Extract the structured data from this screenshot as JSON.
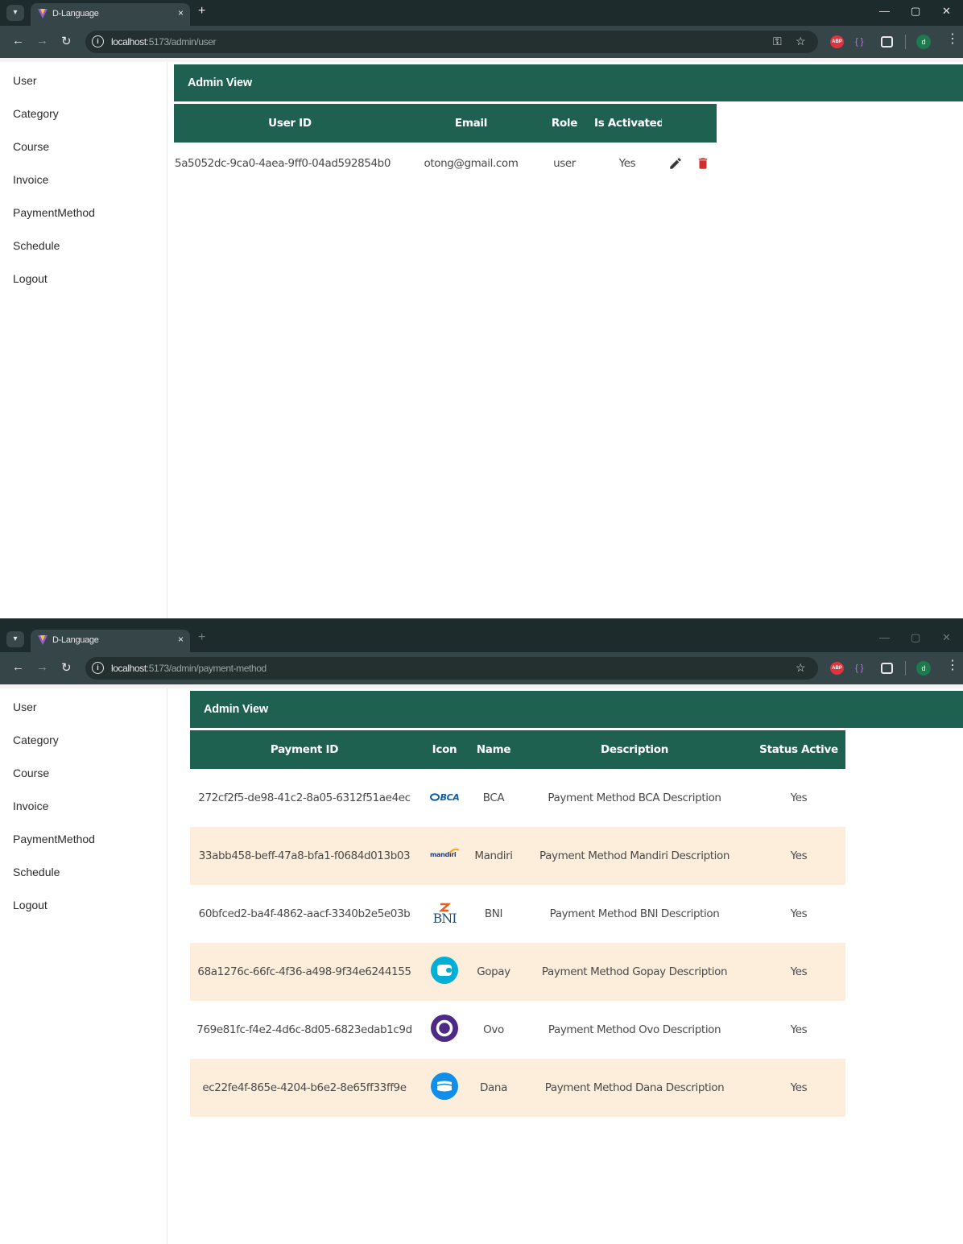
{
  "browser": {
    "tab_title": "D-Language",
    "tab_close": "×",
    "new_tab": "+",
    "menu_dropdown": "⌄"
  },
  "sidebar": {
    "items": [
      {
        "label": "User"
      },
      {
        "label": "Category"
      },
      {
        "label": "Course"
      },
      {
        "label": "Invoice"
      },
      {
        "label": "PaymentMethod"
      },
      {
        "label": "Schedule"
      },
      {
        "label": "Logout"
      }
    ]
  },
  "window1": {
    "url_host": "localhost",
    "url_path": ":5173/admin/user",
    "header_title": "Admin View",
    "table": {
      "columns": [
        "User ID",
        "Email",
        "Role",
        "Is Activated"
      ],
      "rows": [
        {
          "user_id": "5a5052dc-9ca0-4aea-9ff0-04ad592854b0",
          "email": "otong@gmail.com",
          "role": "user",
          "is_activated": "Yes"
        }
      ],
      "edit_icon": "pencil-icon",
      "delete_icon": "trash-icon",
      "delete_color": "#d32f2f"
    }
  },
  "window2": {
    "url_host": "localhost",
    "url_path": ":5173/admin/payment-method",
    "header_title": "Admin View",
    "table": {
      "columns": [
        "Payment ID",
        "Icon",
        "Name",
        "Description",
        "Status Active"
      ],
      "rows": [
        {
          "payment_id": "272cf2f5-de98-41c2-8a05-6312f51ae4ec",
          "icon": "bca-logo",
          "logo_text": "BCA",
          "name": "BCA",
          "description": "Payment Method BCA Description",
          "status": "Yes"
        },
        {
          "payment_id": "33abb458-beff-47a8-bfa1-f0684d013b03",
          "icon": "mandiri-logo",
          "logo_text": "mandiri",
          "name": "Mandiri",
          "description": "Payment Method Mandiri Description",
          "status": "Yes"
        },
        {
          "payment_id": "60bfced2-ba4f-4862-aacf-3340b2e5e03b",
          "icon": "bni-logo",
          "logo_text": "BNI",
          "name": "BNI",
          "description": "Payment Method BNI Description",
          "status": "Yes"
        },
        {
          "payment_id": "68a1276c-66fc-4f36-a498-9f34e6244155",
          "icon": "gopay-logo",
          "logo_text": "",
          "name": "Gopay",
          "description": "Payment Method Gopay Description",
          "status": "Yes"
        },
        {
          "payment_id": "769e81fc-f4e2-4d6c-8d05-6823edab1c9d",
          "icon": "ovo-logo",
          "logo_text": "",
          "name": "Ovo",
          "description": "Payment Method Ovo Description",
          "status": "Yes"
        },
        {
          "payment_id": "ec22fe4f-865e-4204-b6e2-8e65ff33ff9e",
          "icon": "dana-logo",
          "logo_text": "",
          "name": "Dana",
          "description": "Payment Method Dana Description",
          "status": "Yes"
        }
      ]
    }
  },
  "colors": {
    "brand_green": "#1f6150",
    "row_highlight": "#fdeedb",
    "chrome_dark": "#1e2b2d",
    "chrome_toolbar": "#354548"
  }
}
